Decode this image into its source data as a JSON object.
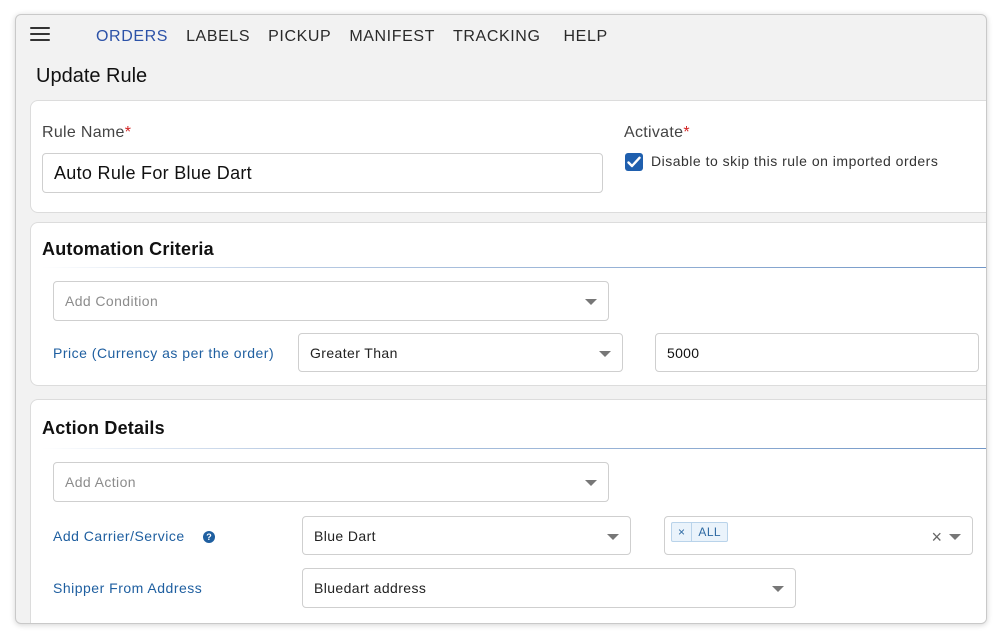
{
  "nav": {
    "items": [
      "ORDERS",
      "LABELS",
      "PICKUP",
      "MANIFEST",
      "TRACKING",
      "HELP"
    ],
    "active": "ORDERS"
  },
  "page": {
    "title": "Update Rule"
  },
  "rule": {
    "name_label": "Rule Name",
    "name_value": "Auto Rule For Blue Dart",
    "activate_label": "Activate",
    "activate_text": "Disable to skip this rule on imported orders",
    "activate_checked": true,
    "required_mark": "*"
  },
  "criteria": {
    "title": "Automation Criteria",
    "add_placeholder": "Add Condition",
    "condition_label": "Price (Currency as per the order)",
    "operator": "Greater Than",
    "value": "5000"
  },
  "action": {
    "title": "Action Details",
    "add_placeholder": "Add Action",
    "carrier_label": "Add Carrier/Service",
    "carrier_value": "Blue Dart",
    "service_tag": "ALL",
    "shipper_label": "Shipper From Address",
    "shipper_value": "Bluedart address"
  },
  "colors": {
    "accent": "#1f5fa0",
    "active_nav": "#2c52a8",
    "required": "#d32222"
  }
}
